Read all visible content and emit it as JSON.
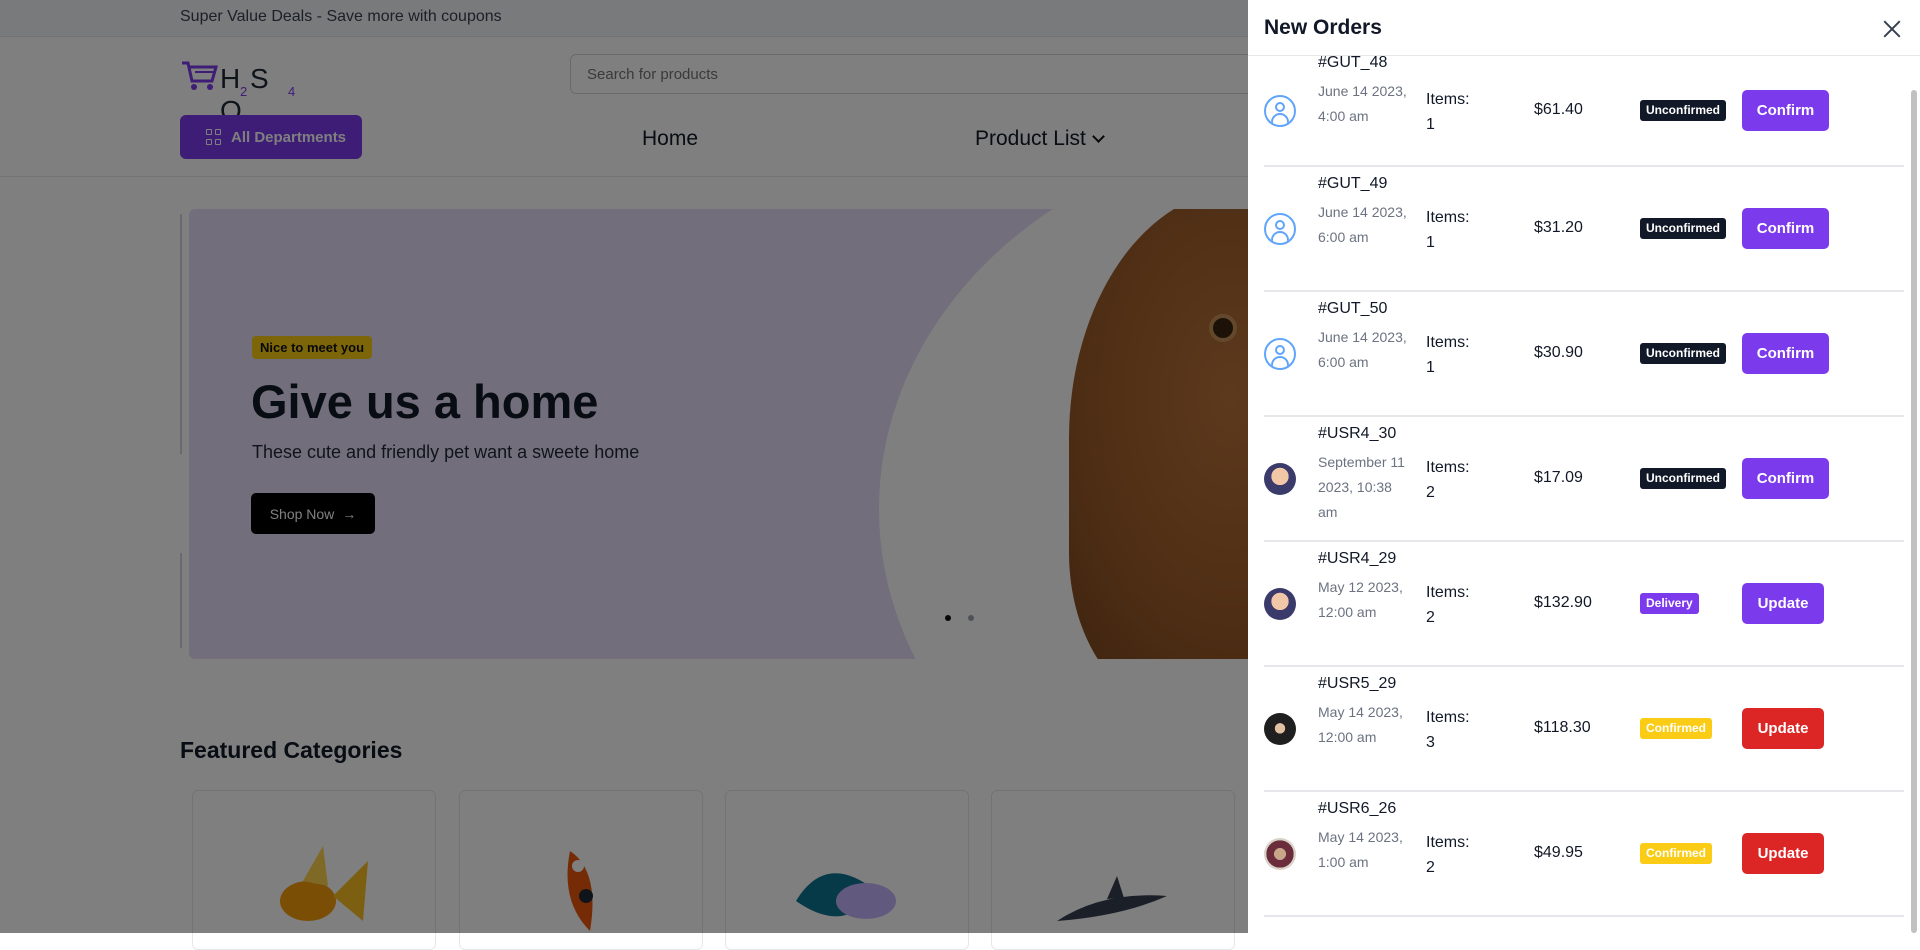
{
  "topbar": {
    "promo": "Super Value Deals - Save more with coupons"
  },
  "header": {
    "logo_text": "H S O",
    "logo_sub_2": "2",
    "logo_sub_4": "4",
    "search_placeholder": "Search for products",
    "departments_label": "All Departments",
    "nav": {
      "home": "Home",
      "product_list": "Product List"
    }
  },
  "hero": {
    "badge": "Nice to meet you",
    "title": "Give us a home",
    "subtitle": "These cute and friendly pet want a sweete home",
    "cta": "Shop Now",
    "cta_arrow": "→"
  },
  "featured": {
    "title": "Featured Categories"
  },
  "drawer": {
    "title": "New Orders",
    "orders": [
      {
        "id": "#GUT_48",
        "date": "June 14 2023, 4:00 am",
        "items_label": "Items:",
        "items": "1",
        "price": "$61.40",
        "status": "Unconfirmed",
        "action": "Confirm"
      },
      {
        "id": "#GUT_49",
        "date": "June 14 2023, 6:00 am",
        "items_label": "Items:",
        "items": "1",
        "price": "$31.20",
        "status": "Unconfirmed",
        "action": "Confirm"
      },
      {
        "id": "#GUT_50",
        "date": "June 14 2023, 6:00 am",
        "items_label": "Items:",
        "items": "1",
        "price": "$30.90",
        "status": "Unconfirmed",
        "action": "Confirm"
      },
      {
        "id": "#USR4_30",
        "date": "September 11 2023, 10:38 am",
        "items_label": "Items:",
        "items": "2",
        "price": "$17.09",
        "status": "Unconfirmed",
        "action": "Confirm"
      },
      {
        "id": "#USR4_29",
        "date": "May 12 2023, 12:00 am",
        "items_label": "Items:",
        "items": "2",
        "price": "$132.90",
        "status": "Delivery",
        "action": "Update"
      },
      {
        "id": "#USR5_29",
        "date": "May 14 2023, 12:00 am",
        "items_label": "Items:",
        "items": "3",
        "price": "$118.30",
        "status": "Confirmed",
        "action": "Update"
      },
      {
        "id": "#USR6_26",
        "date": "May 14 2023, 1:00 am",
        "items_label": "Items:",
        "items": "2",
        "price": "$49.95",
        "status": "Confirmed",
        "action": "Update"
      }
    ]
  },
  "colors": {
    "accent": "#7c3aed",
    "danger": "#dc2626",
    "status_unconfirmed": "#111827",
    "status_confirmed": "#facc15",
    "status_delivery": "#7c3aed"
  }
}
